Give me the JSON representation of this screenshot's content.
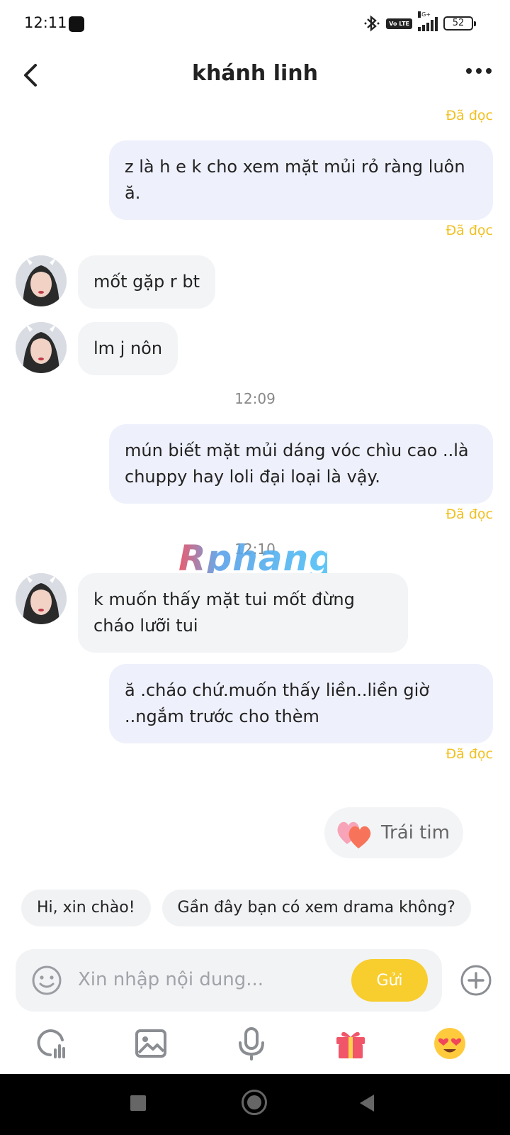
{
  "status_bar": {
    "time": "12:11",
    "network": "4G+",
    "volte": "Vo LTE",
    "battery": "52"
  },
  "header": {
    "title": "khánh linh"
  },
  "messages": {
    "read_label": "Đã đọc",
    "msg1": "z là h e k cho xem mặt mủi rỏ ràng luôn ă.",
    "msg2": "mốt gặp r bt",
    "msg3": "lm j nôn",
    "time1": "12:09",
    "msg4": "mún biết mặt mủi dáng vóc chìu cao ..là chuppy hay loli đại loại là vậy.",
    "time2": "12:10",
    "msg5": "k muốn thấy mặt tui mốt đừng cháo lưỡi tui",
    "msg6": "ă .cháo chứ.muốn thấy liền..liền giờ ..ngắm trước cho thèm",
    "watermark": "Rphang"
  },
  "heart_chip": {
    "label": "Trái tim"
  },
  "suggestions": [
    "Hi, xin chào!",
    "Gần đây bạn có xem drama không?"
  ],
  "input": {
    "placeholder": "Xin nhập nội dung...",
    "send_label": "Gửi"
  },
  "toolbar": {
    "icons": [
      "voice-room-icon",
      "image-icon",
      "microphone-icon",
      "gift-icon",
      "heart-eyes-emoji-icon"
    ]
  },
  "colors": {
    "accent": "#f8cd2e",
    "read_status": "#f0c020",
    "outgoing_bubble": "#eef0fb",
    "incoming_bubble": "#f3f4f6"
  }
}
